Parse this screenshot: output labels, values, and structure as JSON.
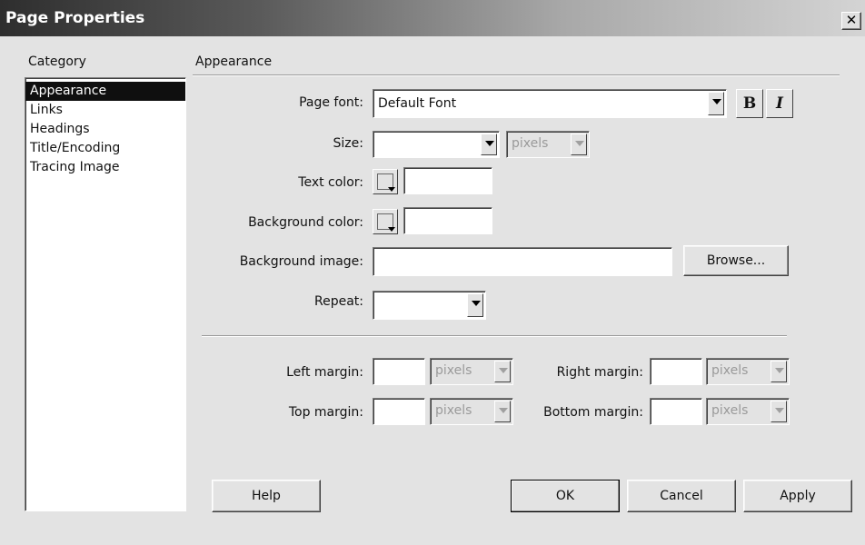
{
  "window": {
    "title": "Page Properties",
    "close_glyph": "✕"
  },
  "category": {
    "heading": "Category",
    "items": [
      "Appearance",
      "Links",
      "Headings",
      "Title/Encoding",
      "Tracing Image"
    ],
    "selected": "Appearance"
  },
  "section": {
    "title": "Appearance"
  },
  "form": {
    "page_font_label": "Page font:",
    "page_font_value": "Default Font",
    "bold_label": "B",
    "italic_label": "I",
    "size_label": "Size:",
    "size_value": "",
    "size_unit": "pixels",
    "text_color_label": "Text color:",
    "text_color_value": "",
    "background_color_label": "Background color:",
    "background_color_value": "",
    "background_image_label": "Background image:",
    "background_image_value": "",
    "browse_label": "Browse...",
    "repeat_label": "Repeat:",
    "repeat_value": ""
  },
  "margins": {
    "left_label": "Left margin:",
    "left_value": "",
    "left_unit": "pixels",
    "right_label": "Right margin:",
    "right_value": "",
    "right_unit": "pixels",
    "top_label": "Top margin:",
    "top_value": "",
    "top_unit": "pixels",
    "bottom_label": "Bottom margin:",
    "bottom_value": "",
    "bottom_unit": "pixels"
  },
  "buttons": {
    "help": "Help",
    "ok": "OK",
    "cancel": "Cancel",
    "apply": "Apply"
  }
}
